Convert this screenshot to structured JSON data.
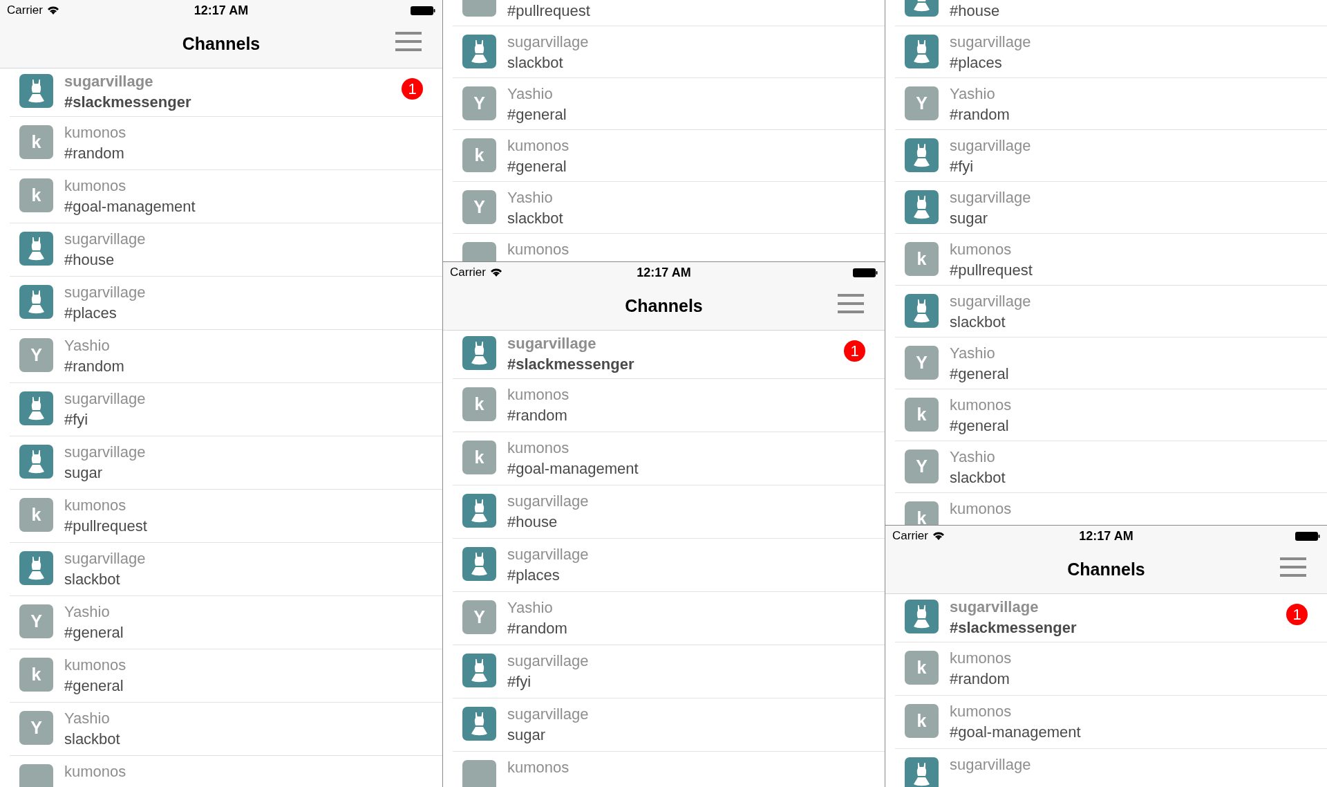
{
  "screens": [
    {
      "status_bar": {
        "carrier": "Carrier",
        "time": "12:17 AM"
      },
      "nav": {
        "title": "Channels"
      },
      "rows": [
        {
          "avatar": {
            "kind": "dress"
          },
          "user": "sugarvillage",
          "channel": "#slackmessenger",
          "unread": true,
          "badge": "1"
        },
        {
          "avatar": {
            "kind": "letter",
            "letter": "k"
          },
          "user": "kumonos",
          "channel": "#random",
          "unread": false
        },
        {
          "avatar": {
            "kind": "letter",
            "letter": "k"
          },
          "user": "kumonos",
          "channel": "#goal-management",
          "unread": false
        },
        {
          "avatar": {
            "kind": "dress"
          },
          "user": "sugarvillage",
          "channel": "#house",
          "unread": false
        },
        {
          "avatar": {
            "kind": "dress"
          },
          "user": "sugarvillage",
          "channel": "#places",
          "unread": false
        },
        {
          "avatar": {
            "kind": "letter",
            "letter": "Y"
          },
          "user": "Yashio",
          "channel": "#random",
          "unread": false
        },
        {
          "avatar": {
            "kind": "dress"
          },
          "user": "sugarvillage",
          "channel": "#fyi",
          "unread": false
        },
        {
          "avatar": {
            "kind": "dress"
          },
          "user": "sugarvillage",
          "channel": "sugar",
          "unread": false
        },
        {
          "avatar": {
            "kind": "letter",
            "letter": "k"
          },
          "user": "kumonos",
          "channel": "#pullrequest",
          "unread": false
        },
        {
          "avatar": {
            "kind": "dress"
          },
          "user": "sugarvillage",
          "channel": "slackbot",
          "unread": false
        },
        {
          "avatar": {
            "kind": "letter",
            "letter": "Y"
          },
          "user": "Yashio",
          "channel": "#general",
          "unread": false
        },
        {
          "avatar": {
            "kind": "letter",
            "letter": "k"
          },
          "user": "kumonos",
          "channel": "#general",
          "unread": false
        },
        {
          "avatar": {
            "kind": "letter",
            "letter": "Y"
          },
          "user": "Yashio",
          "channel": "slackbot",
          "unread": false
        },
        {
          "avatar": {
            "kind": "plain"
          },
          "user": "kumonos",
          "unread": false
        }
      ]
    },
    {
      "scrolled_rows": [
        {
          "avatar": {
            "kind": "plain"
          },
          "channel": "#pullrequest",
          "unread": false
        },
        {
          "avatar": {
            "kind": "dress"
          },
          "user": "sugarvillage",
          "channel": "slackbot",
          "unread": false
        },
        {
          "avatar": {
            "kind": "letter",
            "letter": "Y"
          },
          "user": "Yashio",
          "channel": "#general",
          "unread": false
        },
        {
          "avatar": {
            "kind": "letter",
            "letter": "k"
          },
          "user": "kumonos",
          "channel": "#general",
          "unread": false
        },
        {
          "avatar": {
            "kind": "letter",
            "letter": "Y"
          },
          "user": "Yashio",
          "channel": "slackbot",
          "unread": false
        },
        {
          "avatar": {
            "kind": "plain"
          },
          "user": "kumonos",
          "unread": false
        }
      ],
      "status_bar": {
        "carrier": "Carrier",
        "time": "12:17 AM"
      },
      "nav": {
        "title": "Channels"
      },
      "rows": [
        {
          "avatar": {
            "kind": "dress"
          },
          "user": "sugarvillage",
          "channel": "#slackmessenger",
          "unread": true,
          "badge": "1"
        },
        {
          "avatar": {
            "kind": "letter",
            "letter": "k"
          },
          "user": "kumonos",
          "channel": "#random",
          "unread": false
        },
        {
          "avatar": {
            "kind": "letter",
            "letter": "k"
          },
          "user": "kumonos",
          "channel": "#goal-management",
          "unread": false
        },
        {
          "avatar": {
            "kind": "dress"
          },
          "user": "sugarvillage",
          "channel": "#house",
          "unread": false
        },
        {
          "avatar": {
            "kind": "dress"
          },
          "user": "sugarvillage",
          "channel": "#places",
          "unread": false
        },
        {
          "avatar": {
            "kind": "letter",
            "letter": "Y"
          },
          "user": "Yashio",
          "channel": "#random",
          "unread": false
        },
        {
          "avatar": {
            "kind": "dress"
          },
          "user": "sugarvillage",
          "channel": "#fyi",
          "unread": false
        },
        {
          "avatar": {
            "kind": "dress"
          },
          "user": "sugarvillage",
          "channel": "sugar",
          "unread": false
        },
        {
          "avatar": {
            "kind": "plain"
          },
          "user": "kumonos",
          "unread": false
        }
      ]
    },
    {
      "scrolled_rows": [
        {
          "avatar": {
            "kind": "dress"
          },
          "channel": "#house",
          "unread": false
        },
        {
          "avatar": {
            "kind": "dress"
          },
          "user": "sugarvillage",
          "channel": "#places",
          "unread": false
        },
        {
          "avatar": {
            "kind": "letter",
            "letter": "Y"
          },
          "user": "Yashio",
          "channel": "#random",
          "unread": false
        },
        {
          "avatar": {
            "kind": "dress"
          },
          "user": "sugarvillage",
          "channel": "#fyi",
          "unread": false
        },
        {
          "avatar": {
            "kind": "dress"
          },
          "user": "sugarvillage",
          "channel": "sugar",
          "unread": false
        },
        {
          "avatar": {
            "kind": "letter",
            "letter": "k"
          },
          "user": "kumonos",
          "channel": "#pullrequest",
          "unread": false
        },
        {
          "avatar": {
            "kind": "dress"
          },
          "user": "sugarvillage",
          "channel": "slackbot",
          "unread": false
        },
        {
          "avatar": {
            "kind": "letter",
            "letter": "Y"
          },
          "user": "Yashio",
          "channel": "#general",
          "unread": false
        },
        {
          "avatar": {
            "kind": "letter",
            "letter": "k"
          },
          "user": "kumonos",
          "channel": "#general",
          "unread": false
        },
        {
          "avatar": {
            "kind": "letter",
            "letter": "Y"
          },
          "user": "Yashio",
          "channel": "slackbot",
          "unread": false
        },
        {
          "avatar": {
            "kind": "letter",
            "letter": "k"
          },
          "user": "kumonos",
          "unread": false
        }
      ],
      "status_bar": {
        "carrier": "Carrier",
        "time": "12:17 AM"
      },
      "nav": {
        "title": "Channels"
      },
      "rows": [
        {
          "avatar": {
            "kind": "dress"
          },
          "user": "sugarvillage",
          "channel": "#slackmessenger",
          "unread": true,
          "badge": "1"
        },
        {
          "avatar": {
            "kind": "letter",
            "letter": "k"
          },
          "user": "kumonos",
          "channel": "#random",
          "unread": false
        },
        {
          "avatar": {
            "kind": "letter",
            "letter": "k"
          },
          "user": "kumonos",
          "channel": "#goal-management",
          "unread": false
        },
        {
          "avatar": {
            "kind": "dress"
          },
          "user": "sugarvillage",
          "unread": false
        }
      ]
    }
  ]
}
